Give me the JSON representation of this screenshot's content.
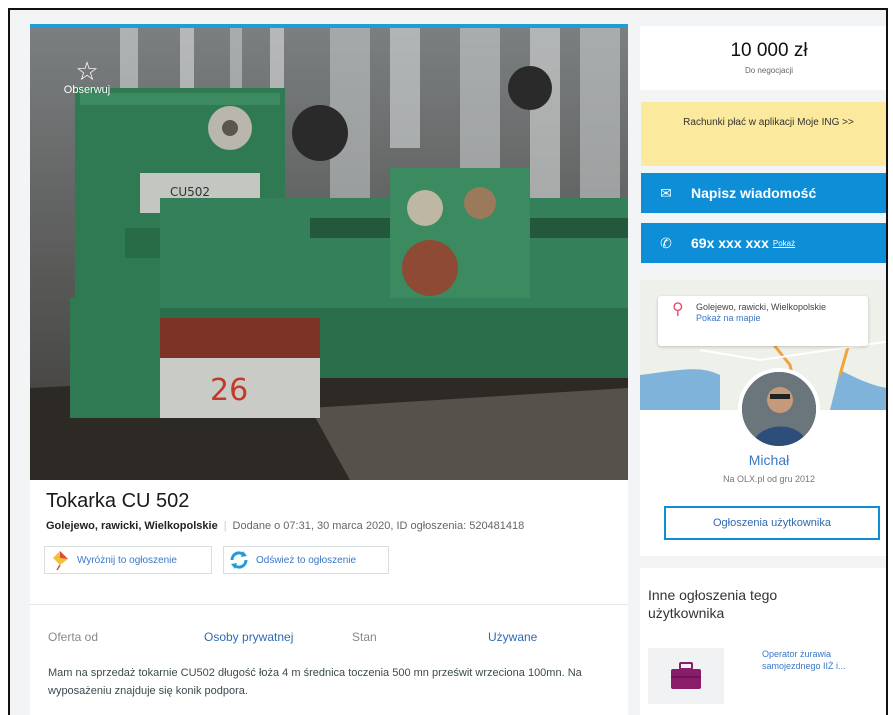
{
  "listing": {
    "title": "Tokarka CU 502",
    "location": "Golejewo, rawicki, Wielkopolskie",
    "added": "Dodane o 07:31, 30 marca 2020, ID ogłoszenia: 520481418",
    "observe_label": "Obserwuj",
    "promote_label": "Wyróżnij to ogłoszenie",
    "refresh_label": "Odśwież to ogłoszenie",
    "params": [
      {
        "label": "Oferta od",
        "value": "Osoby prywatnej"
      },
      {
        "label": "Stan",
        "value": "Używane"
      }
    ],
    "description": "Mam na sprzedaż tokarnie CU502 długość łoża 4 m średnica toczenia 500 mn prześwit wrzeciona 100mn. Na wyposażeniu znajduje się konik podpora."
  },
  "sidebar": {
    "price": "10 000 zł",
    "negotiable": "Do negocjacji",
    "banner": "Rachunki płać w aplikacji Moje ING >>",
    "message_button": "Napisz wiadomość",
    "phone": "69x xxx xxx",
    "phone_show": "Pokaż",
    "map": {
      "location": "Golejewo, rawicki, Wielkopolskie",
      "show_on_map": "Pokaż na mapie"
    },
    "user": {
      "name": "Michał",
      "since": "Na OLX.pl od gru 2012",
      "ads_button": "Ogłoszenia użytkownika"
    },
    "other_ads": {
      "title": "Inne ogłoszenia tego użytkownika",
      "items": [
        {
          "label": "Operator żurawia samojezdnego IIŻ i..."
        }
      ]
    }
  },
  "colors": {
    "accent_blue": "#0f8ed8",
    "banner_yellow": "#fbe99d",
    "link_blue": "#3a77c8"
  }
}
